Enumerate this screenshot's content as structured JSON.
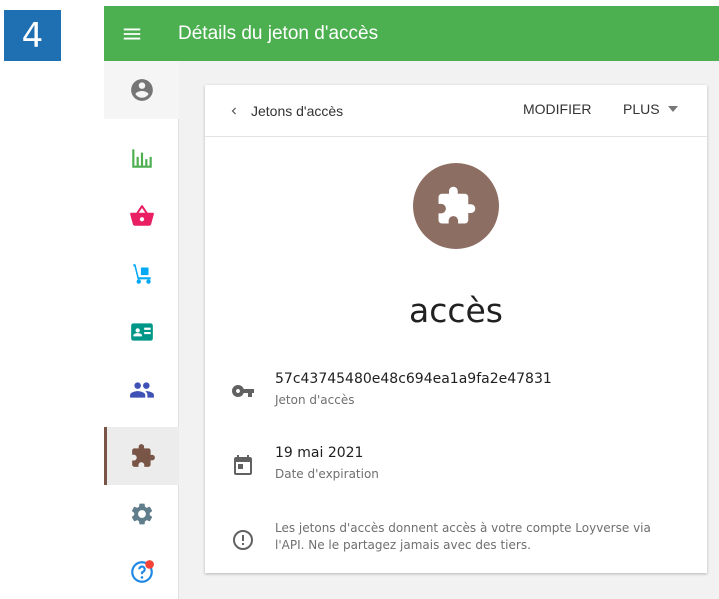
{
  "step_number": "4",
  "header": {
    "title": "Détails du jeton d'accès"
  },
  "sidebar": {
    "items": [
      {
        "icon": "account-circle-icon"
      },
      {
        "icon": "bar-chart-icon",
        "color": "#4caf50"
      },
      {
        "icon": "basket-icon",
        "color": "#e91e63"
      },
      {
        "icon": "inventory-dolly-icon",
        "color": "#03a9f4"
      },
      {
        "icon": "customer-card-icon",
        "color": "#009688"
      },
      {
        "icon": "people-icon",
        "color": "#3f51b5"
      },
      {
        "icon": "puzzle-icon",
        "color": "#795548",
        "active": true
      },
      {
        "icon": "gear-icon",
        "color": "#607d8b"
      },
      {
        "icon": "help-icon",
        "color": "#1e88e5",
        "notification_dot": "#f44336"
      }
    ]
  },
  "card": {
    "back_label": "Jetons d'accès",
    "edit_label": "MODIFIER",
    "more_label": "PLUS",
    "token_name": "accès",
    "avatar_color": "#8d6e63",
    "token_value": "57c43745480e48c694ea1a9fa2e47831",
    "token_caption": "Jeton d'accès",
    "expiry_value": "19 mai 2021",
    "expiry_caption": "Date d'expiration",
    "note": "Les jetons d'accès donnent accès à votre compte Loyverse via l'API. Ne le partagez jamais avec des tiers."
  },
  "colors": {
    "topbar": "#4caf50",
    "step_badge": "#1f6fb3"
  }
}
